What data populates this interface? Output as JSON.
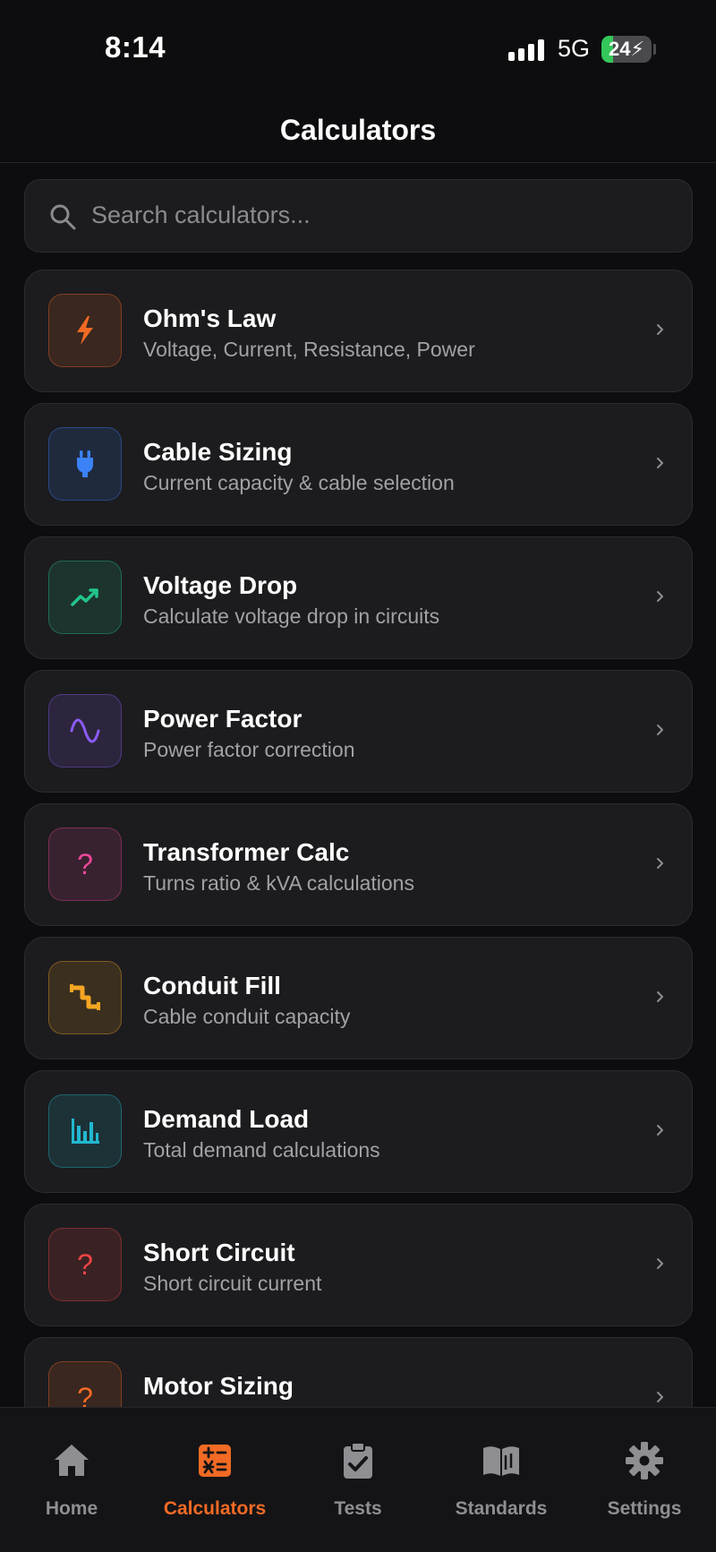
{
  "status": {
    "time": "8:14",
    "network": "5G",
    "battery": "24"
  },
  "header": {
    "title": "Calculators"
  },
  "search": {
    "placeholder": "Search calculators..."
  },
  "colors": {
    "accent": "#f26a24",
    "background": "#0d0d0f",
    "card": "#1c1c1f"
  },
  "calculators": [
    {
      "title": "Ohm's Law",
      "subtitle": "Voltage, Current, Resistance, Power",
      "icon": "bolt-icon",
      "color": "#f26a24"
    },
    {
      "title": "Cable Sizing",
      "subtitle": "Current capacity & cable selection",
      "icon": "plug-icon",
      "color": "#3b82f6"
    },
    {
      "title": "Voltage Drop",
      "subtitle": "Calculate voltage drop in circuits",
      "icon": "trending-line-icon",
      "color": "#22c58b"
    },
    {
      "title": "Power Factor",
      "subtitle": "Power factor correction",
      "icon": "sine-wave-icon",
      "color": "#8b5cf6"
    },
    {
      "title": "Transformer Calc",
      "subtitle": "Turns ratio & kVA calculations",
      "icon": "question-icon",
      "color": "#ec4899"
    },
    {
      "title": "Conduit Fill",
      "subtitle": "Cable conduit capacity",
      "icon": "pipe-icon",
      "color": "#f5a623"
    },
    {
      "title": "Demand Load",
      "subtitle": "Total demand calculations",
      "icon": "bar-chart-icon",
      "color": "#22b8cf"
    },
    {
      "title": "Short Circuit",
      "subtitle": "Short circuit current",
      "icon": "question-icon",
      "color": "#ef4444"
    },
    {
      "title": "Motor Sizing",
      "subtitle": "",
      "icon": "question-icon",
      "color": "#f26a24"
    }
  ],
  "tabs": [
    {
      "label": "Home",
      "icon": "home-icon",
      "active": false
    },
    {
      "label": "Calculators",
      "icon": "calculator-icon",
      "active": true
    },
    {
      "label": "Tests",
      "icon": "clipboard-check-icon",
      "active": false
    },
    {
      "label": "Standards",
      "icon": "book-icon",
      "active": false
    },
    {
      "label": "Settings",
      "icon": "gear-icon",
      "active": false
    }
  ]
}
